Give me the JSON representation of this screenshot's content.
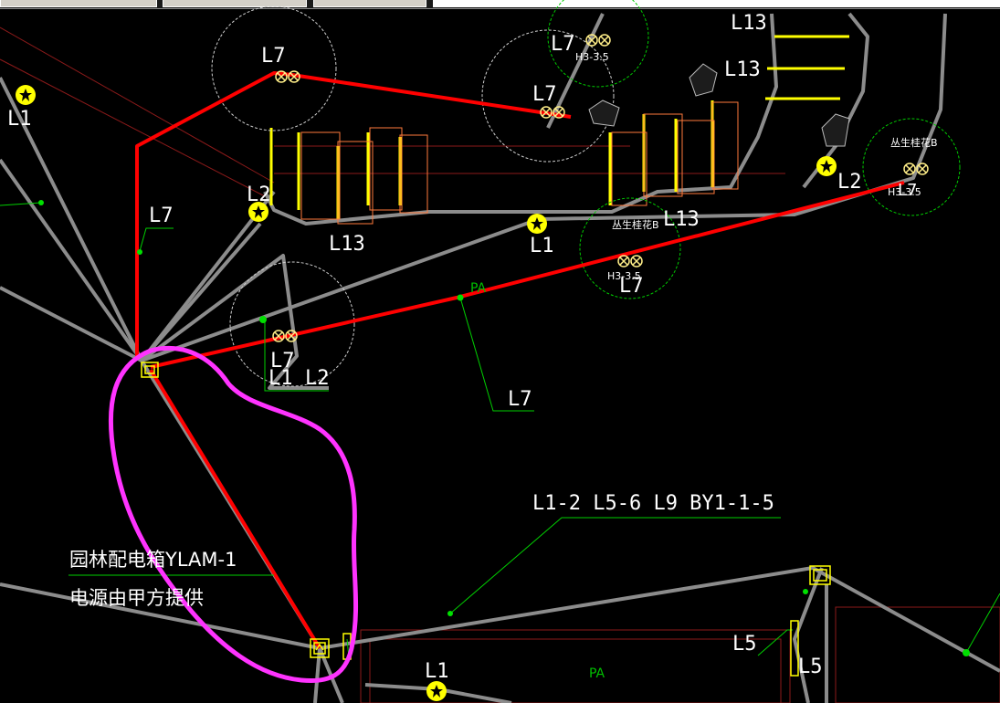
{
  "drawing": {
    "labels": {
      "l7_top_left": "L7",
      "l1_left": "L1",
      "l7_top_right_tree": "L7",
      "l7_center_tree": "L7",
      "h3_top": "H3-3.5",
      "l13_top": "L13",
      "l13_top2": "L13",
      "l2_right": "L2",
      "shrub_name_right": "丛生桂花B",
      "h3_right": "H3-3.5",
      "l7_right_tree": "L7",
      "l2_mid": "L2",
      "l7_side": "L7",
      "l13_mid_left": "L13",
      "l1_mid": "L1",
      "l13_mid": "L13",
      "shrub_name_mid": "丛生桂花B",
      "h3_mid": "H3-3.5",
      "l7_mid_tree": "L7",
      "pa_line": "PA",
      "l7_tree_bottom": "L7",
      "l1_tree_bottom": "L1",
      "l2_tree_bottom": "L2",
      "l7_leader": "L7",
      "circuit_leader": "L1-2 L5-6 L9 BY1-1-5",
      "box_name": "园林配电箱YLAM-1",
      "box_note": "电源由甲方提供",
      "l5_a": "L5",
      "l5_b": "L5",
      "l1_bottom": "L1",
      "pa_bottom": "PA"
    }
  }
}
